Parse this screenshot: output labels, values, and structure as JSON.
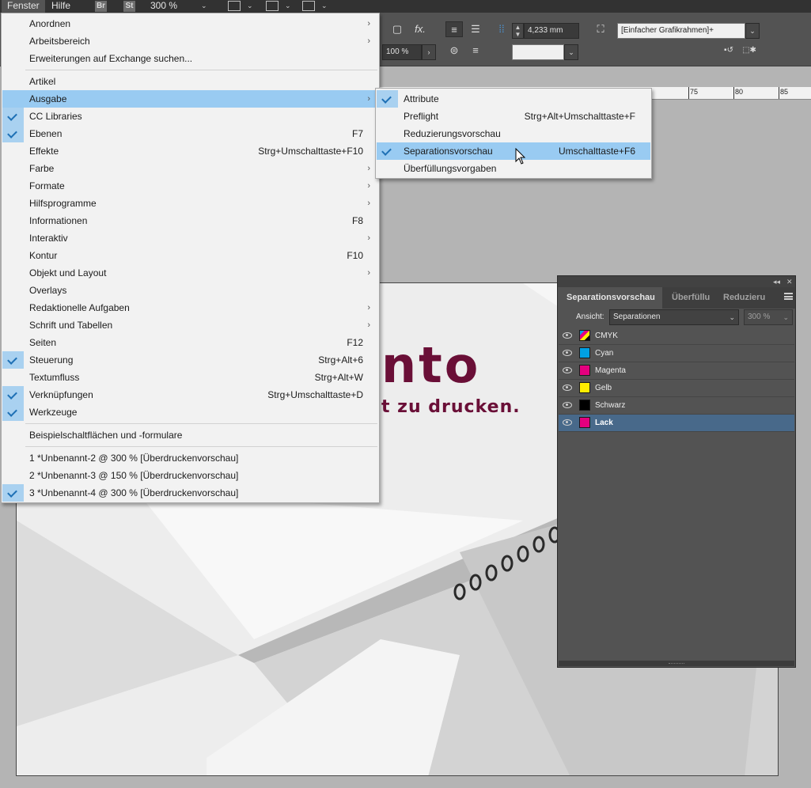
{
  "menubar": {
    "items": [
      "Fenster",
      "Hilfe"
    ],
    "badges": [
      "Br",
      "St"
    ],
    "zoom": "300 %"
  },
  "control_bar": {
    "stroke_value": "4,233 mm",
    "scale_value": "100 %",
    "fx_label": "fx.",
    "frame_style": "[Einfacher Grafikrahmen]+"
  },
  "ruler": {
    "labels": [
      "75",
      "80",
      "85"
    ]
  },
  "document": {
    "logo_text": "nto",
    "tagline": "t zu drucken.",
    "colors": {
      "brand": "#6a0f37"
    }
  },
  "fenster_menu": {
    "items": [
      {
        "label": "Anordnen",
        "shortcut": "",
        "submenu": true,
        "checked": false
      },
      {
        "label": "Arbeitsbereich",
        "shortcut": "",
        "submenu": true,
        "checked": false
      },
      {
        "label": "Erweiterungen auf Exchange suchen...",
        "shortcut": "",
        "submenu": false,
        "checked": false
      },
      {
        "label": "Artikel",
        "shortcut": "",
        "submenu": false,
        "checked": false
      },
      {
        "label": "Ausgabe",
        "shortcut": "",
        "submenu": true,
        "checked": false,
        "highlighted": true
      },
      {
        "label": "CC Libraries",
        "shortcut": "",
        "submenu": false,
        "checked": true
      },
      {
        "label": "Ebenen",
        "shortcut": "F7",
        "submenu": false,
        "checked": true
      },
      {
        "label": "Effekte",
        "shortcut": "Strg+Umschalttaste+F10",
        "submenu": false,
        "checked": false
      },
      {
        "label": "Farbe",
        "shortcut": "",
        "submenu": true,
        "checked": false
      },
      {
        "label": "Formate",
        "shortcut": "",
        "submenu": true,
        "checked": false
      },
      {
        "label": "Hilfsprogramme",
        "shortcut": "",
        "submenu": true,
        "checked": false
      },
      {
        "label": "Informationen",
        "shortcut": "F8",
        "submenu": false,
        "checked": false
      },
      {
        "label": "Interaktiv",
        "shortcut": "",
        "submenu": true,
        "checked": false
      },
      {
        "label": "Kontur",
        "shortcut": "F10",
        "submenu": false,
        "checked": false
      },
      {
        "label": "Objekt und Layout",
        "shortcut": "",
        "submenu": true,
        "checked": false
      },
      {
        "label": "Overlays",
        "shortcut": "",
        "submenu": false,
        "checked": false
      },
      {
        "label": "Redaktionelle Aufgaben",
        "shortcut": "",
        "submenu": true,
        "checked": false
      },
      {
        "label": "Schrift und Tabellen",
        "shortcut": "",
        "submenu": true,
        "checked": false
      },
      {
        "label": "Seiten",
        "shortcut": "F12",
        "submenu": false,
        "checked": false
      },
      {
        "label": "Steuerung",
        "shortcut": "Strg+Alt+6",
        "submenu": false,
        "checked": true
      },
      {
        "label": "Textumfluss",
        "shortcut": "Strg+Alt+W",
        "submenu": false,
        "checked": false
      },
      {
        "label": "Verknüpfungen",
        "shortcut": "Strg+Umschalttaste+D",
        "submenu": false,
        "checked": true
      },
      {
        "label": "Werkzeuge",
        "shortcut": "",
        "submenu": false,
        "checked": true
      },
      {
        "label": "Beispielschaltflächen und -formulare",
        "shortcut": "",
        "submenu": false,
        "checked": false
      },
      {
        "label": "1 *Unbenannt-2 @ 300 % [Überdruckenvorschau]",
        "shortcut": "",
        "submenu": false,
        "checked": false
      },
      {
        "label": "2 *Unbenannt-3 @ 150 % [Überdruckenvorschau]",
        "shortcut": "",
        "submenu": false,
        "checked": false
      },
      {
        "label": "3 *Unbenannt-4 @ 300 % [Überdruckenvorschau]",
        "shortcut": "",
        "submenu": false,
        "checked": true
      }
    ]
  },
  "ausgabe_submenu": {
    "items": [
      {
        "label": "Attribute",
        "shortcut": "",
        "checked": true
      },
      {
        "label": "Preflight",
        "shortcut": "Strg+Alt+Umschalttaste+F",
        "checked": false
      },
      {
        "label": "Reduzierungsvorschau",
        "shortcut": "",
        "checked": false
      },
      {
        "label": "Separationsvorschau",
        "shortcut": "Umschalttaste+F6",
        "checked": true,
        "highlighted": true
      },
      {
        "label": "Überfüllungsvorgaben",
        "shortcut": "",
        "checked": false
      }
    ]
  },
  "separation_panel": {
    "tabs": [
      "Separationsvorschau",
      "Überfüllu",
      "Reduzieru"
    ],
    "view_label": "Ansicht:",
    "view_value": "Separationen",
    "zoom_value": "300 %",
    "separations": [
      {
        "name": "CMYK",
        "color": "cmyk",
        "selected": false
      },
      {
        "name": "Cyan",
        "color": "#00a0e3",
        "selected": false
      },
      {
        "name": "Magenta",
        "color": "#e4007f",
        "selected": false
      },
      {
        "name": "Gelb",
        "color": "#ffed00",
        "selected": false
      },
      {
        "name": "Schwarz",
        "color": "#000000",
        "selected": false
      },
      {
        "name": "Lack",
        "color": "#e4007f",
        "selected": true
      }
    ]
  }
}
